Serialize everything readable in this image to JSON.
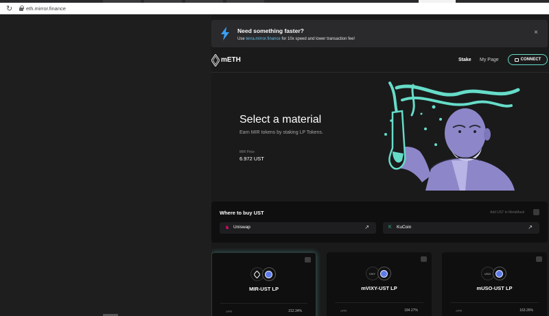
{
  "browser": {
    "url": "eth.mirror.finance",
    "reload_icon": "reload-icon",
    "lock_icon": "lock-icon"
  },
  "banner": {
    "title": "Need something faster?",
    "sub_prefix": "Use ",
    "sub_link": "terra.mirror.finance",
    "sub_suffix": " for 10x speed and lower transaction fee!",
    "close": "×",
    "icon": "lightning-bolt-icon",
    "bolt_color": "#3aa0f5"
  },
  "nav": {
    "brand": "mETH",
    "stake": "Stake",
    "mypage": "My Page",
    "connect": "CONNECT",
    "accent": "#66dcc8"
  },
  "hero": {
    "title": "Select a material",
    "subtitle": "Earn MIR tokens by staking LP Tokens.",
    "price_label": "MIR Price",
    "price_value": "6.972 UST"
  },
  "buy": {
    "title": "Where to buy UST",
    "add_metamask": "Add UST to MetaMask",
    "exchanges": [
      {
        "name": "Uniswap",
        "icon": "uniswap-icon",
        "arrow": "↗",
        "color": "#ff007a"
      },
      {
        "name": "KuCoin",
        "icon": "kucoin-icon",
        "arrow": "↗",
        "color": "#24ae8f"
      }
    ]
  },
  "cards": [
    {
      "name": "MIR-UST LP",
      "token": "",
      "apr_label": "APR",
      "apr": "212.34%"
    },
    {
      "name": "mVIXY-UST LP",
      "token": "VIXY",
      "apr_label": "APR",
      "apr": "184.27%"
    },
    {
      "name": "mUSO-UST LP",
      "token": "USO",
      "apr_label": "APR",
      "apr": "163.26%"
    }
  ]
}
